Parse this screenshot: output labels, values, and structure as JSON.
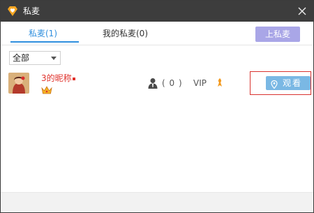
{
  "window": {
    "title": "私麦",
    "title_icon": "heart-diamond-icon",
    "close_icon": "close-icon"
  },
  "tabs": [
    {
      "label": "私麦(1)",
      "active": true
    },
    {
      "label": "我的私麦(0)",
      "active": false
    }
  ],
  "actions": {
    "up_mic_label": "上私麦"
  },
  "filter": {
    "selected": "全部"
  },
  "rows": [
    {
      "nickname": "3的昵称",
      "viewer_count": "( 0 )",
      "vip_label": "VIP",
      "watch_label": "观看"
    }
  ],
  "colors": {
    "titlebar": "#3d3d3d",
    "accent": "#2f8fde",
    "up_button": "#a9a6e7",
    "watch_button": "#7ab8e4",
    "highlight_frame": "#d9332f",
    "nickname": "#e0312b"
  }
}
